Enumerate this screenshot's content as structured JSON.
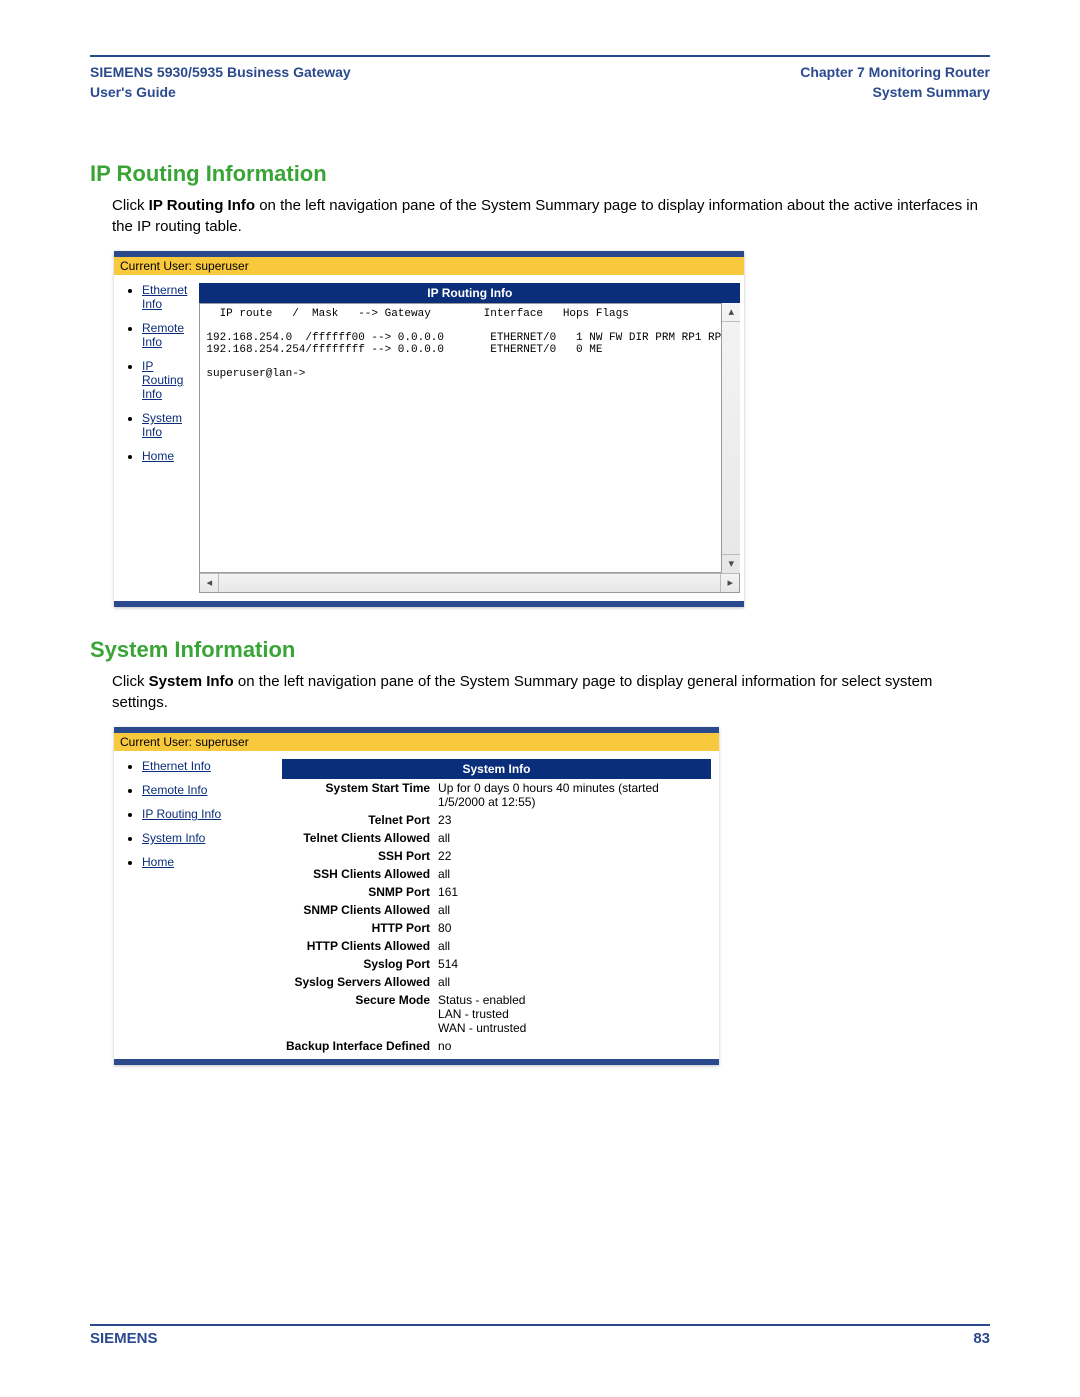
{
  "header": {
    "left_line1": "SIEMENS 5930/5935 Business Gateway",
    "left_line2": "User's Guide",
    "right_line1": "Chapter 7  Monitoring Router",
    "right_line2": "System Summary"
  },
  "section1": {
    "title": "IP Routing Information",
    "intro_pre": "Click ",
    "intro_bold": "IP Routing Info",
    "intro_post": " on the left navigation pane of the System Summary page to display information about the active interfaces in the IP routing table.",
    "panel": {
      "userbar": "Current User: superuser",
      "nav": [
        "Ethernet Info",
        "Remote Info",
        "IP Routing Info",
        "System Info",
        "Home"
      ],
      "title": "IP Routing Info",
      "console": "  IP route   /  Mask   --> Gateway        Interface   Hops Flags\n\n192.168.254.0  /ffffff00 --> 0.0.0.0       ETHERNET/0   1 NW FW DIR PRM RP1 RP\n192.168.254.254/ffffffff --> 0.0.0.0       ETHERNET/0   0 ME\n\nsuperuser@lan->"
    }
  },
  "section2": {
    "title": "System Information",
    "intro_pre": "Click ",
    "intro_bold": "System Info",
    "intro_post": " on the left navigation pane of the System Summary page to display general information for select system settings.",
    "panel": {
      "userbar": "Current User: superuser",
      "nav": [
        "Ethernet Info",
        "Remote Info",
        "IP Routing Info",
        "System Info",
        "Home"
      ],
      "title": "System Info",
      "rows": [
        {
          "k": "System Start Time",
          "v": "Up for 0 days 0 hours 40 minutes (started 1/5/2000 at 12:55)"
        },
        {
          "k": "Telnet Port",
          "v": "23"
        },
        {
          "k": "Telnet Clients Allowed",
          "v": "all"
        },
        {
          "k": "SSH Port",
          "v": "22"
        },
        {
          "k": "SSH Clients Allowed",
          "v": "all"
        },
        {
          "k": "SNMP Port",
          "v": "161"
        },
        {
          "k": "SNMP Clients Allowed",
          "v": "all"
        },
        {
          "k": "HTTP Port",
          "v": "80"
        },
        {
          "k": "HTTP Clients Allowed",
          "v": "all"
        },
        {
          "k": "Syslog Port",
          "v": "514"
        },
        {
          "k": "Syslog Servers Allowed",
          "v": "all"
        },
        {
          "k": "Secure Mode",
          "v": "Status - enabled\nLAN - trusted\nWAN - untrusted"
        },
        {
          "k": "Backup Interface Defined",
          "v": "no"
        }
      ]
    }
  },
  "footer": {
    "brand": "SIEMENS",
    "page": "83"
  }
}
